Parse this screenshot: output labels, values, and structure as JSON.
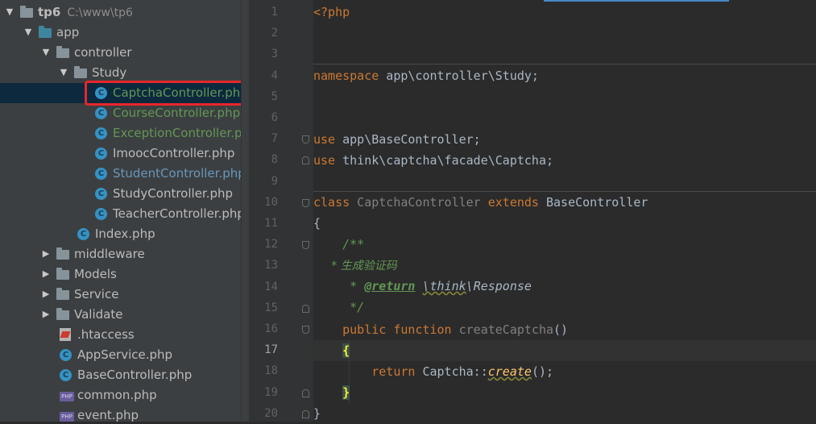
{
  "tree": {
    "rows": [
      {
        "arrow": "▼",
        "icon": "folder",
        "label": "tp6",
        "sub": "C:\\www\\tp6"
      },
      {
        "arrow": "▼",
        "icon": "folder-blue",
        "label": "app"
      },
      {
        "arrow": "▼",
        "icon": "folder",
        "label": "controller"
      },
      {
        "arrow": "▼",
        "icon": "folder",
        "label": "Study"
      },
      {
        "icon": "class",
        "label": "CaptchaController.php",
        "color": "green",
        "selected": true
      },
      {
        "icon": "class",
        "label": "CourseController.php",
        "color": "green"
      },
      {
        "icon": "class",
        "label": "ExceptionController.php",
        "color": "green"
      },
      {
        "icon": "class",
        "label": "ImoocController.php"
      },
      {
        "icon": "class",
        "label": "StudentController.php",
        "color": "blue"
      },
      {
        "icon": "class",
        "label": "StudyController.php"
      },
      {
        "icon": "class",
        "label": "TeacherController.php"
      },
      {
        "icon": "class",
        "label": "Index.php"
      },
      {
        "arrow": "▶",
        "icon": "folder",
        "label": "middleware"
      },
      {
        "arrow": "▶",
        "icon": "folder",
        "label": "Models"
      },
      {
        "arrow": "▶",
        "icon": "folder",
        "label": "Service"
      },
      {
        "arrow": "▶",
        "icon": "folder",
        "label": "Validate"
      },
      {
        "icon": "htaccess",
        "label": ".htaccess"
      },
      {
        "icon": "class",
        "label": "AppService.php"
      },
      {
        "icon": "class",
        "label": "BaseController.php"
      },
      {
        "icon": "php",
        "label": "common.php"
      },
      {
        "icon": "php",
        "label": "event.php"
      }
    ]
  },
  "gutter": {
    "current_line": 17,
    "lines": [
      "1",
      "2",
      "3",
      "4",
      "5",
      "6",
      "7",
      "8",
      "9",
      "10",
      "11",
      "12",
      "13",
      "14",
      "15",
      "16",
      "17",
      "18",
      "19",
      "20"
    ]
  },
  "code": {
    "l1": "<?php",
    "l4_kw": "namespace",
    "l4_rest": " app\\controller\\Study;",
    "l7_kw": "use",
    "l7_rest": " app\\BaseController;",
    "l8_kw": "use",
    "l8_rest": " think\\captcha\\facade\\Captcha;",
    "l10_kw": "class",
    "l10_name": " CaptchaController ",
    "l10_ext": "extends",
    "l10_base": " BaseController",
    "l11": "{",
    "l12": "    /**",
    "l13": "     * 生成验证码",
    "l14_pre": "     * ",
    "l14_tag": "@return",
    "l14_sp": " ",
    "l14_ns1": "\\think",
    "l14_ns2": "\\",
    "l14_cls": "Response",
    "l15": "     */",
    "l16_pre": "    ",
    "l16_kw1": "public",
    "l16_sp": " ",
    "l16_kw2": "function",
    "l16_fn": " createCaptcha",
    "l16_paren": "()",
    "l17_pre": "    ",
    "l17_brace": "{",
    "l18_pre": "        ",
    "l18_kw": "return",
    "l18_cls": " Captcha::",
    "l18_fn": "create",
    "l18_end": "();",
    "l19_pre": "    ",
    "l19_brace": "}",
    "l20": "}"
  }
}
